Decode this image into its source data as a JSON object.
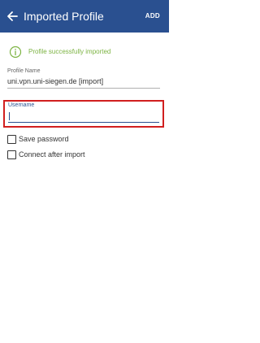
{
  "appbar": {
    "title": "Imported Profile",
    "add_label": "ADD",
    "back_icon": "arrow-left-icon",
    "background_color": "#2a5090"
  },
  "notice": {
    "text": "Profile successfully imported",
    "icon": "info-circle-icon",
    "color": "#7cb342"
  },
  "profile_name": {
    "label": "Profile Name",
    "value": "uni.vpn.uni-siegen.de [import]"
  },
  "username": {
    "label": "Username",
    "value": "",
    "highlight_color": "#d11f1f"
  },
  "options": [
    {
      "label": "Save password",
      "checked": false
    },
    {
      "label": "Connect after import",
      "checked": false
    }
  ]
}
